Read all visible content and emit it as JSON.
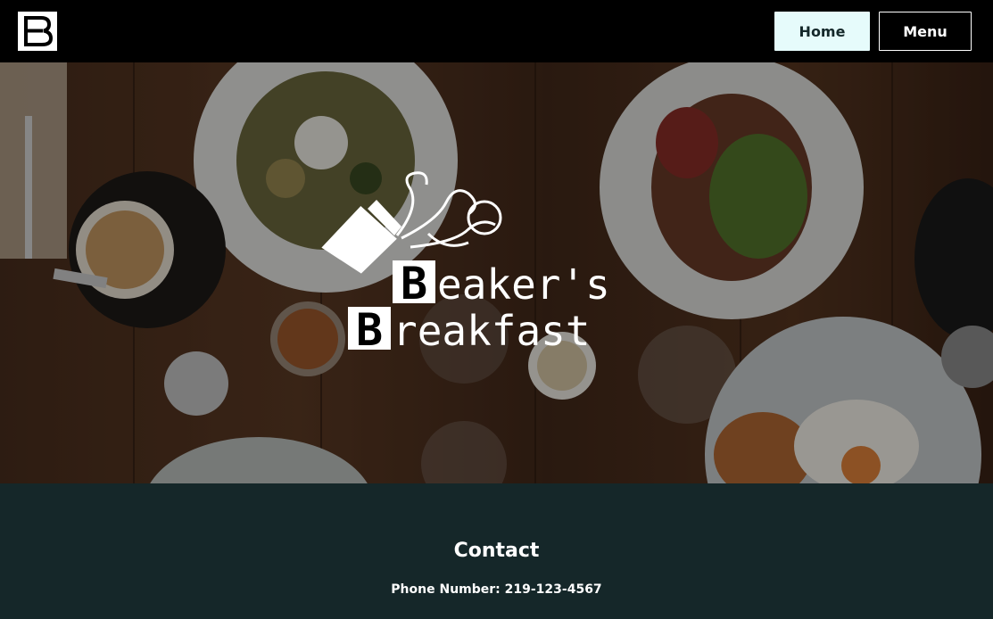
{
  "nav": {
    "logo_icon": "beakers-b-logo-icon",
    "home_label": "Home",
    "menu_label": "Menu"
  },
  "hero": {
    "background": "breakfast-table-photo",
    "logo_icon": "beaker-pouring-icon",
    "brand_line1": "Beaker's",
    "brand_line2": "Breakfast"
  },
  "contact": {
    "title": "Contact",
    "phone_label": "Phone Number: 219-123-4567"
  },
  "colors": {
    "nav_background": "#000000",
    "home_button_background": "#e6fbfb",
    "contact_background": "#152729",
    "text": "#ffffff"
  }
}
